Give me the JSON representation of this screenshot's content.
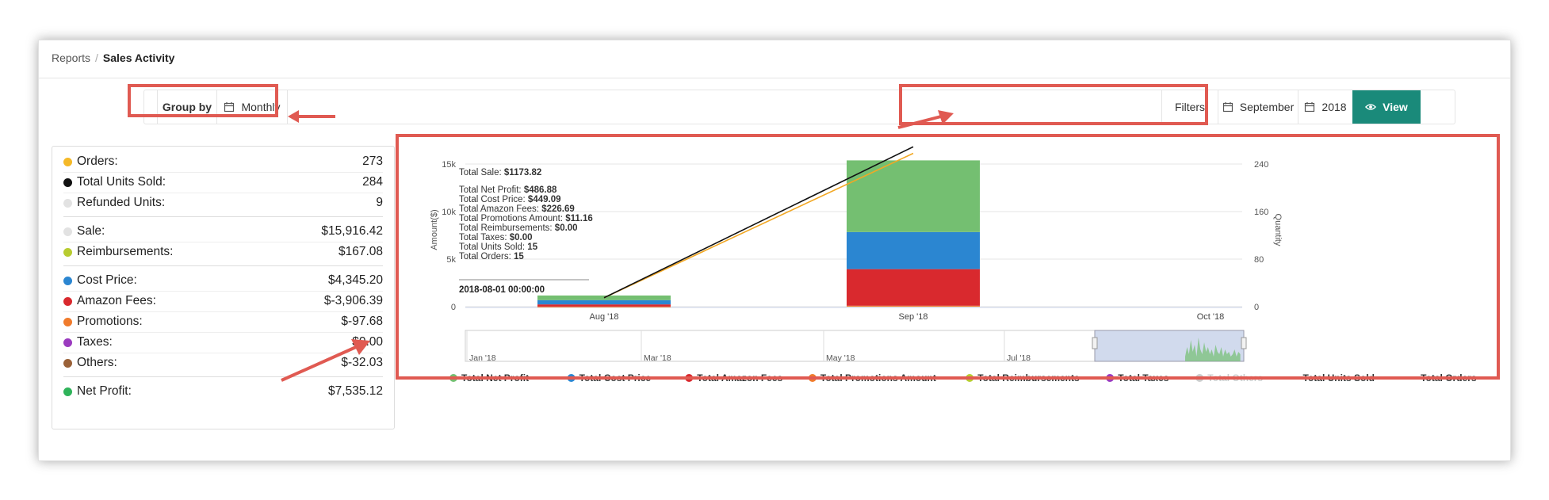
{
  "breadcrumb": {
    "parent": "Reports",
    "current": "Sales Activity"
  },
  "toolbar": {
    "group_by_label": "Group by",
    "group_by_value": "Monthly",
    "filters_label": "Filters",
    "month": "September",
    "year": "2018",
    "view_label": "View"
  },
  "colors": {
    "accent": "#1a8a7a",
    "highlight": "#e05a52",
    "net_profit": "#74bf71",
    "cost_price": "#2b86d1",
    "amazon_fees": "#d9292e",
    "promotions": "#f07b2c",
    "reimbursements": "#b8cc30",
    "taxes": "#9b3bbf",
    "others": "#dddddd",
    "units_sold": "#111111",
    "orders": "#f2a824"
  },
  "summary": {
    "groups": [
      [
        {
          "label": "Orders:",
          "value": "273",
          "color": "#f5b928"
        },
        {
          "label": "Total Units Sold:",
          "value": "284",
          "color": "#111111"
        },
        {
          "label": "Refunded Units:",
          "value": "9",
          "color": "#e2e2e2"
        }
      ],
      [
        {
          "label": "Sale:",
          "value": "$15,916.42",
          "color": "#e2e2e2"
        },
        {
          "label": "Reimbursements:",
          "value": "$167.08",
          "color": "#b8cc30"
        }
      ],
      [
        {
          "label": "Cost Price:",
          "value": "$4,345.20",
          "color": "#2b86d1"
        },
        {
          "label": "Amazon Fees:",
          "value": "$-3,906.39",
          "color": "#d9292e"
        },
        {
          "label": "Promotions:",
          "value": "$-97.68",
          "color": "#f07b2c"
        },
        {
          "label": "Taxes:",
          "value": "$0.00",
          "color": "#9b3bbf"
        },
        {
          "label": "Others:",
          "value": "$-32.03",
          "color": "#9a6138"
        }
      ],
      [
        {
          "label": "Net Profit:",
          "value": "$7,535.12",
          "color": "#2fb35a"
        }
      ]
    ]
  },
  "chart_data": {
    "type": "bar",
    "categories": [
      "Aug '18",
      "Sep '18",
      "Oct '18"
    ],
    "ylabel": "Amount($)",
    "y2label": "Quantity",
    "ylim": [
      0,
      15000
    ],
    "y2lim": [
      0,
      240
    ],
    "yticks": [
      "0",
      "5k",
      "10k",
      "15k"
    ],
    "y2ticks": [
      "0",
      "80",
      "160",
      "240"
    ],
    "series": [
      {
        "name": "Total Net Profit",
        "values": [
          486.88,
          7535.12,
          null
        ]
      },
      {
        "name": "Total Cost Price",
        "values": [
          449.09,
          3900,
          null
        ]
      },
      {
        "name": "Total Amazon Fees",
        "values": [
          226.69,
          3850,
          null
        ]
      },
      {
        "name": "Total Promotions Amount",
        "values": [
          11.16,
          97.68,
          null
        ]
      },
      {
        "name": "Total Reimbursements",
        "values": [
          0,
          0,
          null
        ]
      },
      {
        "name": "Total Taxes",
        "values": [
          0,
          0,
          null
        ]
      },
      {
        "name": "Total Others",
        "values": [
          0,
          32.03,
          null
        ]
      },
      {
        "name": "Total Units Sold",
        "values": [
          15,
          269,
          null
        ]
      },
      {
        "name": "Total Orders",
        "values": [
          15,
          258,
          null
        ]
      }
    ],
    "tooltip": {
      "title_label": "Total Sale:",
      "title_value": "$1173.82",
      "rows": [
        [
          "Total Net Profit:",
          "$486.88"
        ],
        [
          "Total Cost Price:",
          "$449.09"
        ],
        [
          "Total Amazon Fees:",
          "$226.69"
        ],
        [
          "Total Promotions Amount:",
          "$11.16"
        ],
        [
          "Total Reimbursements:",
          "$0.00"
        ],
        [
          "Total Taxes:",
          "$0.00"
        ],
        [
          "Total Units Sold:",
          "15"
        ],
        [
          "Total Orders:",
          "15"
        ]
      ],
      "date": "2018-08-01 00:00:00"
    },
    "navigator_labels": [
      "Jan '18",
      "Mar '18",
      "May '18",
      "Jul '18"
    ],
    "legend": [
      {
        "name": "Total Net Profit",
        "kind": "dot",
        "color": "#74bf71"
      },
      {
        "name": "Total Cost Price",
        "kind": "dot",
        "color": "#2b86d1"
      },
      {
        "name": "Total Amazon Fees",
        "kind": "dot",
        "color": "#d9292e"
      },
      {
        "name": "Total Promotions Amount",
        "kind": "dot",
        "color": "#f07b2c"
      },
      {
        "name": "Total Reimbursements",
        "kind": "dot",
        "color": "#b8cc30"
      },
      {
        "name": "Total Taxes",
        "kind": "dot",
        "color": "#9b3bbf"
      },
      {
        "name": "Total Others",
        "kind": "dot",
        "color": "#cccccc",
        "disabled": true
      },
      {
        "name": "Total Units Sold",
        "kind": "line",
        "color": "#111111"
      },
      {
        "name": "Total Orders",
        "kind": "line",
        "color": "#f2a824"
      }
    ]
  }
}
